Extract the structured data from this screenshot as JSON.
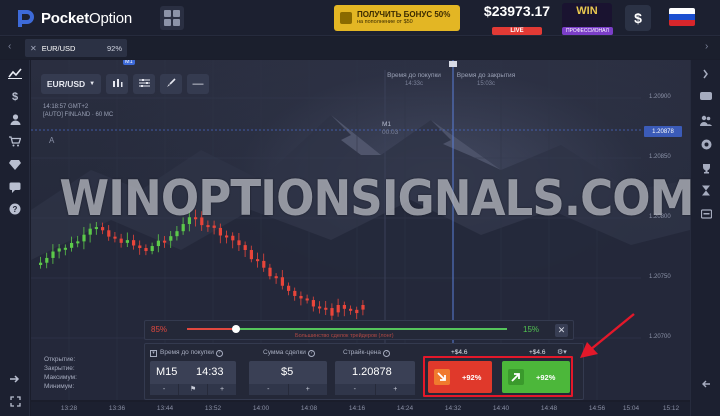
{
  "header": {
    "logo_bold": "Pocket",
    "logo_regular": "Option",
    "bonus_title": "ПОЛУЧИТЬ БОНУС 50%",
    "bonus_subtitle": "на пополнение от $50",
    "balance": "$23973.17",
    "account_type": "LIVE",
    "win_label": "WIN",
    "win_sub": "ПРОФЕССИОНАЛ",
    "dollar_label": "$",
    "colors": {
      "accent": "#3d6ad8",
      "bonus": "#e3b624",
      "live": "#e23a35"
    }
  },
  "asset_tab": {
    "close_label": "✕",
    "pair": "EUR/USD",
    "payout": "92%"
  },
  "chart": {
    "pair_button": "EUR/USD",
    "timeframe_badge": "M1",
    "time_info": "14:18:57 GMT+2",
    "indicator_info": "[AUTO] FINLAND · 60 MC",
    "label_a": "A",
    "purchase_time_label": "Время до покупки",
    "purchase_time_value": "14:33c",
    "close_time_label": "Время до закрытия",
    "close_time_value": "15:03c",
    "m1_label": "M1",
    "m1_value": "00:03",
    "current_price": "1.20878",
    "price_ticks": [
      "1.20900",
      "1.20850",
      "1.20800",
      "1.20750",
      "1.20700"
    ],
    "watermark": "WINOPTIONSIGNALS.COM"
  },
  "sentiment": {
    "left_pct": "85%",
    "right_pct": "15%",
    "caption": "Большинство сделок трейдеров (лонг)",
    "close_label": "✕",
    "split": 0.85
  },
  "trade_panel": {
    "time_header": "Время до покупки",
    "amount_header": "Сумма сделки",
    "strike_header": "Страйк-цена",
    "timeframe": "M15",
    "time_value": "14:33",
    "amount": "$5",
    "strike": "1.20878",
    "minus": "-",
    "plus": "+",
    "payout_down_top": "+$4.6",
    "payout_up_top": "+$4.6",
    "down_pct": "+92%",
    "up_pct": "+92%",
    "settings_label": "⚙▾"
  },
  "stats": {
    "items": [
      "Открытие:",
      "Закрытие:",
      "Максимум:",
      "Минимум:"
    ]
  },
  "time_axis": [
    "13:28",
    "13:36",
    "13:44",
    "13:52",
    "14:00",
    "14:08",
    "14:16",
    "14:24",
    "14:32",
    "14:40",
    "14:48",
    "14:56",
    "15:04",
    "15:12"
  ]
}
